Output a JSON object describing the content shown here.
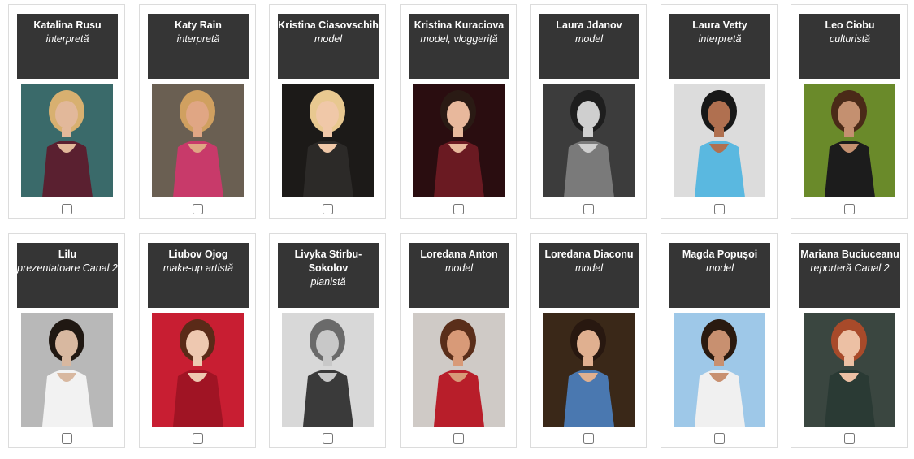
{
  "people": [
    {
      "name": "Katalina Rusu",
      "role": "interpretă",
      "bg": "#3a6a6a",
      "fg": "#5a2030",
      "skin": "#e2b89a",
      "hair": "#d8b070"
    },
    {
      "name": "Katy Rain",
      "role": "interpretă",
      "bg": "#6a5f52",
      "fg": "#c83a6a",
      "skin": "#e0a684",
      "hair": "#d0a060"
    },
    {
      "name": "Kristina Ciasovschih",
      "role": "model",
      "bg": "#1c1a18",
      "fg": "#2c2a28",
      "skin": "#f0c8a8",
      "hair": "#e8c890"
    },
    {
      "name": "Kristina Kuraciova",
      "role": "model, vloggeriță",
      "bg": "#2a0d10",
      "fg": "#6a1a22",
      "skin": "#e8b89c",
      "hair": "#2a1a14"
    },
    {
      "name": "Laura Jdanov",
      "role": "model",
      "bg": "#3c3c3c",
      "fg": "#7a7a7a",
      "skin": "#cfcfcf",
      "hair": "#1e1e1e"
    },
    {
      "name": "Laura Vetty",
      "role": "interpretă",
      "bg": "#dcdcdc",
      "fg": "#5ab8e0",
      "skin": "#b07050",
      "hair": "#181818"
    },
    {
      "name": "Leo Ciobu",
      "role": "culturistă",
      "bg": "#6a8a2a",
      "fg": "#1c1c1c",
      "skin": "#c49070",
      "hair": "#4a2a18"
    },
    {
      "name": "Lilu",
      "role": "prezentatoare Canal 2",
      "bg": "#b8b8b8",
      "fg": "#f2f2f2",
      "skin": "#d8b8a0",
      "hair": "#201812"
    },
    {
      "name": "Liubov Ojog",
      "role": "make-up artistă",
      "bg": "#c81e32",
      "fg": "#a01424",
      "skin": "#eec8b0",
      "hair": "#5a2a18"
    },
    {
      "name": "Livyka Stirbu-Sokolov",
      "role": "pianistă",
      "bg": "#d8d8d8",
      "fg": "#3a3a3a",
      "skin": "#c8c8c8",
      "hair": "#6a6a6a"
    },
    {
      "name": "Loredana Anton",
      "role": "model",
      "bg": "#cfcac6",
      "fg": "#b81e2a",
      "skin": "#d89a78",
      "hair": "#5a2e1a"
    },
    {
      "name": "Loredana Diaconu",
      "role": "model",
      "bg": "#3a2818",
      "fg": "#4a78b0",
      "skin": "#e0b090",
      "hair": "#281810"
    },
    {
      "name": "Magda Popușoi",
      "role": "model",
      "bg": "#9ec8e8",
      "fg": "#f0f0f0",
      "skin": "#c89070",
      "hair": "#2a1a10"
    },
    {
      "name": "Mariana Buciuceanu",
      "role": "reporteră Canal 2",
      "bg": "#3a4640",
      "fg": "#2a3a34",
      "skin": "#ecc0a4",
      "hair": "#a84a2a"
    }
  ]
}
